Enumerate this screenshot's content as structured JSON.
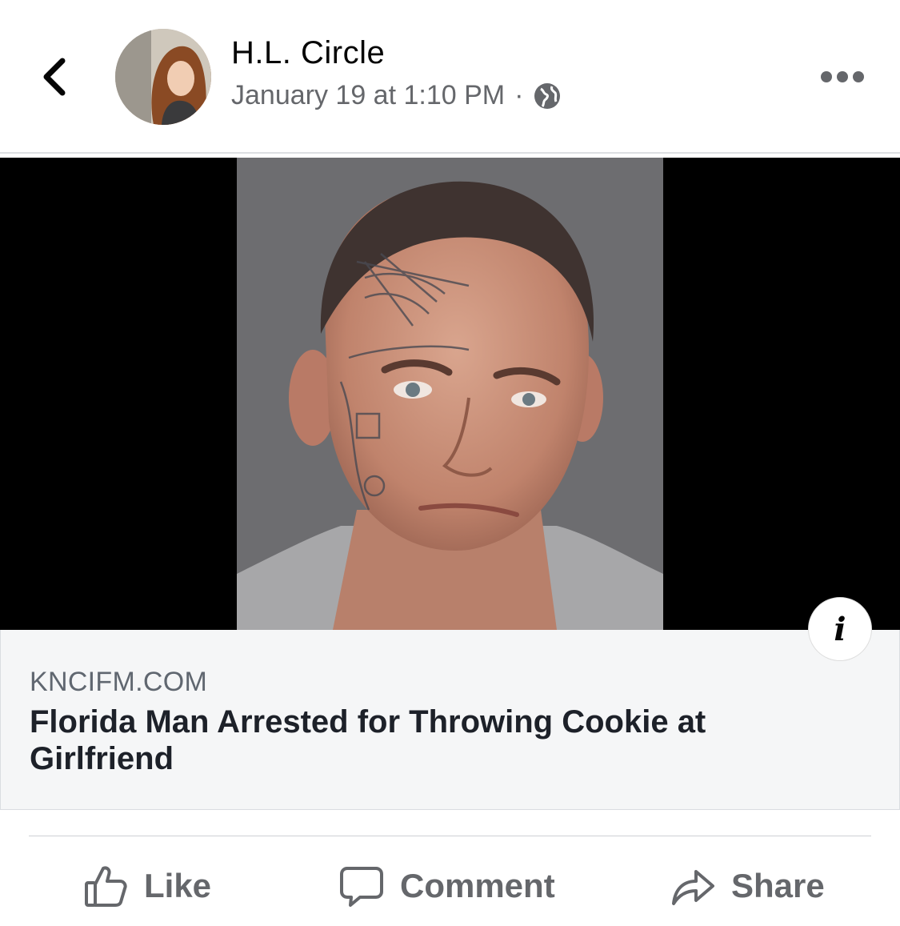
{
  "post": {
    "author": "H.L. Circle",
    "timestamp": "January 19 at 1:10 PM",
    "separator": "·",
    "privacy_icon": "globe-icon",
    "back_icon": "chevron-left-icon",
    "more_icon": "more-horizontal-icon"
  },
  "link_card": {
    "domain": "KNCIFM.COM",
    "title": "Florida Man Arrested for Throwing Cookie at Girlfriend",
    "info_glyph": "i"
  },
  "actions": {
    "like": "Like",
    "comment": "Comment",
    "share": "Share"
  },
  "colors": {
    "text_primary": "#050505",
    "text_secondary": "#65676b",
    "card_background": "#f5f6f7"
  }
}
